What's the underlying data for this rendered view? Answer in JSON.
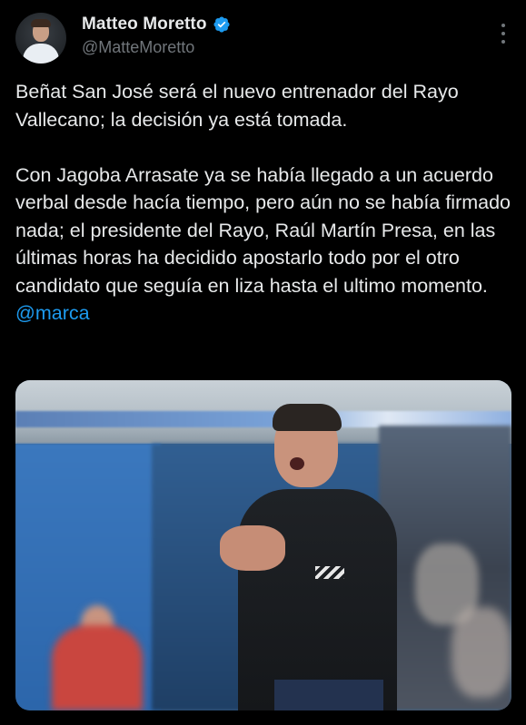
{
  "author": {
    "display_name": "Matteo Moretto",
    "handle": "@MatteMoretto",
    "verified": true
  },
  "tweet": {
    "text": "Beñat San José será el nuevo entrenador del Rayo Vallecano; la decisión ya está tomada.\n\nCon Jagoba Arrasate ya se había llegado a un acuerdo verbal desde hacía tiempo, pero aún no se había firmado nada; el presidente del Rayo, Raúl Martín Presa, en las últimas horas ha decidido apostarlo todo por el otro candidato que seguía en liza hasta el ultimo momento.",
    "mention": "@marca"
  },
  "icons": {
    "verified": "verified-badge-icon",
    "more": "more-options-icon"
  },
  "colors": {
    "background": "#000000",
    "text": "#e7e9ea",
    "secondary_text": "#71767b",
    "link": "#1d9bf0"
  }
}
